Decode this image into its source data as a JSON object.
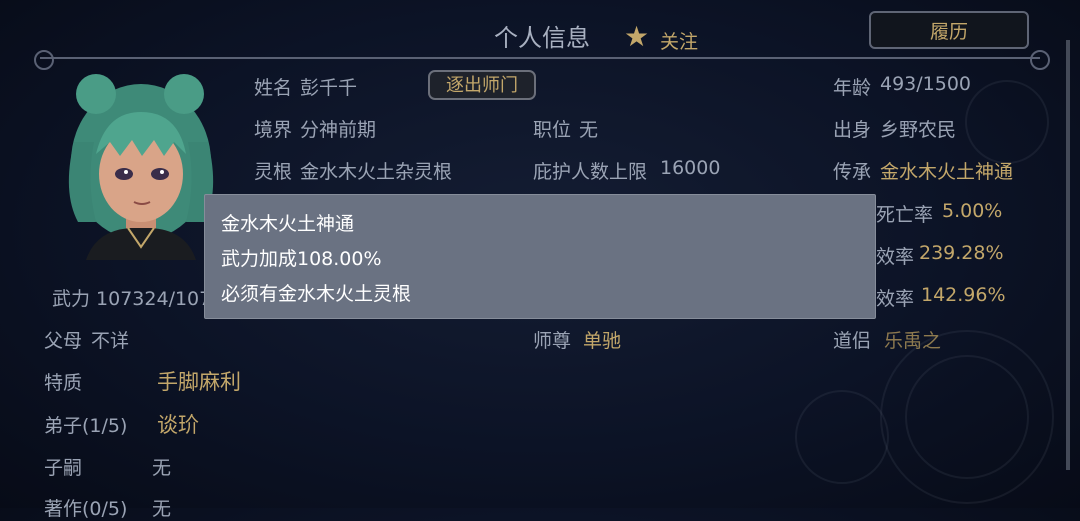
{
  "header": {
    "title": "个人信息",
    "follow_label": "关注",
    "history_button": "履历"
  },
  "profile": {
    "name_label": "姓名",
    "name_value": "彭千千",
    "expel_button": "逐出师门",
    "age_label": "年龄",
    "age_value": "493/1500",
    "realm_label": "境界",
    "realm_value": "分神前期",
    "position_label": "职位",
    "position_value": "无",
    "origin_label": "出身",
    "origin_value": "乡野农民",
    "root_label": "灵根",
    "root_value": "金水木火土杂灵根",
    "protect_label": "庇护人数上限",
    "protect_value": "16000",
    "inherit_label": "传承",
    "inherit_value": "金水木火土神通",
    "death_rate_partial": "死亡率",
    "death_rate_value": "5.00%",
    "efficiency1_partial": "效率",
    "efficiency1_value": "239.28%",
    "efficiency2_partial": "效率",
    "efficiency2_value": "142.96%",
    "force_text": "武力 107324/107",
    "parents_label": "父母",
    "parents_value": "不详",
    "master_label": "师尊",
    "master_value": "单驰",
    "partner_label": "道侣",
    "partner_value": "乐禹之",
    "trait_label": "特质",
    "trait_value": "手脚麻利",
    "disciple_label": "弟子(1/5)",
    "disciple_value": "谈玠",
    "heir_label": "子嗣",
    "heir_value": "无",
    "works_label": "著作(0/5)",
    "works_value": "无"
  },
  "tooltip": {
    "line1": "金水木火土神通",
    "line2": "武力加成108.00%",
    "line3": "必须有金水木火土灵根"
  },
  "colors": {
    "background": "#0c1326",
    "gold_text": "#c3a76a",
    "label_text": "#9aa3b4",
    "tooltip_bg": "#6a7282"
  }
}
